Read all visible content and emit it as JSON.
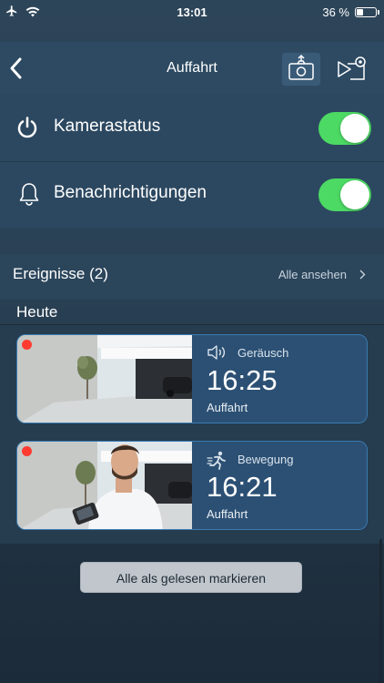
{
  "status_bar": {
    "time": "13:01",
    "battery": "36 %",
    "battery_level": 0.36
  },
  "navbar": {
    "title": "Auffahrt",
    "icons": [
      "back-chevron-icon",
      "snapshot-camera-icon",
      "video-settings-icon"
    ]
  },
  "toggles": [
    {
      "label": "Kamerastatus",
      "icon": "power-icon",
      "on": true
    },
    {
      "label": "Benachrichtigungen",
      "icon": "bell-icon",
      "on": true
    }
  ],
  "events": {
    "title": "Ereignisse (2)",
    "view_all": "Alle ansehen",
    "group_label": "Heute",
    "items": [
      {
        "type": "Geräusch",
        "icon": "speaker-icon",
        "time": "16:25",
        "location": "Auffahrt",
        "unread": true
      },
      {
        "type": "Bewegung",
        "icon": "running-person-icon",
        "time": "16:21",
        "location": "Auffahrt",
        "unread": true
      }
    ]
  },
  "mark_all_read": "Alle als gelesen markieren",
  "colors": {
    "toggle_on": "#4cd964",
    "card_border": "#3a7bb3",
    "unread_dot": "#ff3b30"
  }
}
